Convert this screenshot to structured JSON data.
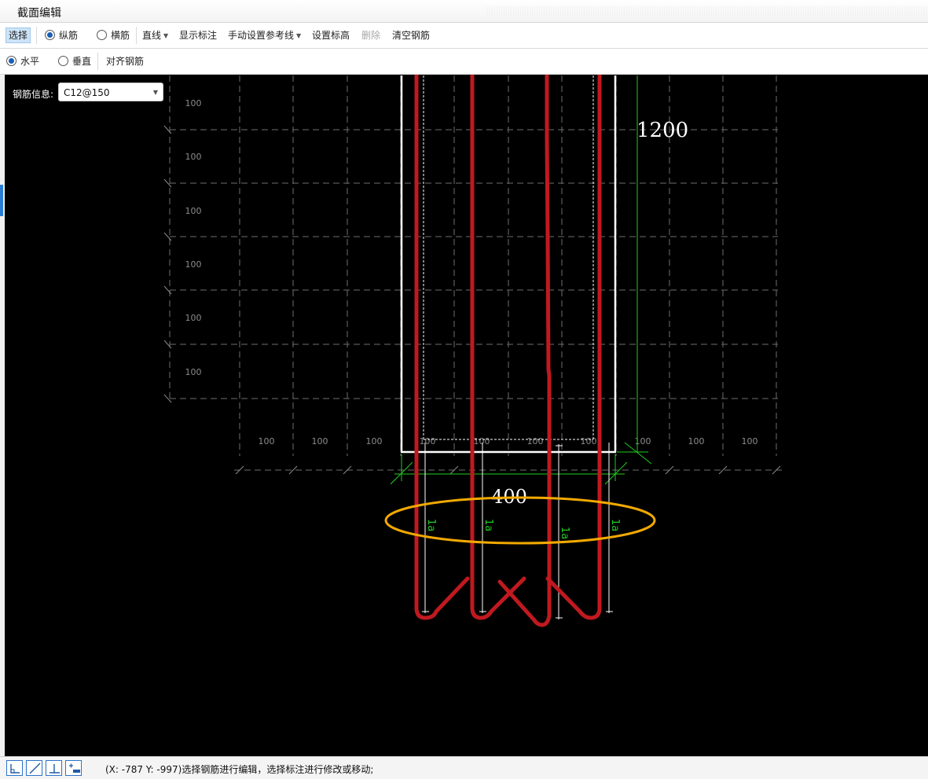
{
  "window": {
    "title": "截面编辑"
  },
  "toolbar1": {
    "select": "选择",
    "longitudinal": "纵筋",
    "transverse": "横筋",
    "line": "直线",
    "show_dimension": "显示标注",
    "manual_reference": "手动设置参考线",
    "set_elevation": "设置标高",
    "delete": "删除",
    "clear_rebar": "清空钢筋"
  },
  "toolbar2": {
    "horizontal": "水平",
    "vertical": "垂直",
    "align_rebar": "对齐钢筋"
  },
  "rebar_info": {
    "label": "钢筋信息:",
    "value": "C12@150"
  },
  "drawing": {
    "grid_left_labels": [
      "100",
      "100",
      "100",
      "100",
      "100",
      "100"
    ],
    "grid_bottom_labels": [
      "100",
      "100",
      "100",
      "100",
      "100",
      "100",
      "100",
      "100",
      "100",
      "100"
    ],
    "dim_height": "1200",
    "dim_width": "400",
    "anchor_labels": [
      "1a",
      "1a",
      "1a",
      "1a"
    ],
    "colors": {
      "rebar": "#c0191f",
      "outline": "#ffffff",
      "dimension": "#22cc22",
      "highlight": "#f2a900",
      "grid": "#808080"
    }
  },
  "status": {
    "text": "(X: -787 Y: -997)选择钢筋进行编辑，选择标注进行修改或移动;",
    "buttons": [
      "angle-tool-icon",
      "diagonal-tool-icon",
      "perpendicular-tool-icon",
      "add-segment-icon"
    ]
  }
}
